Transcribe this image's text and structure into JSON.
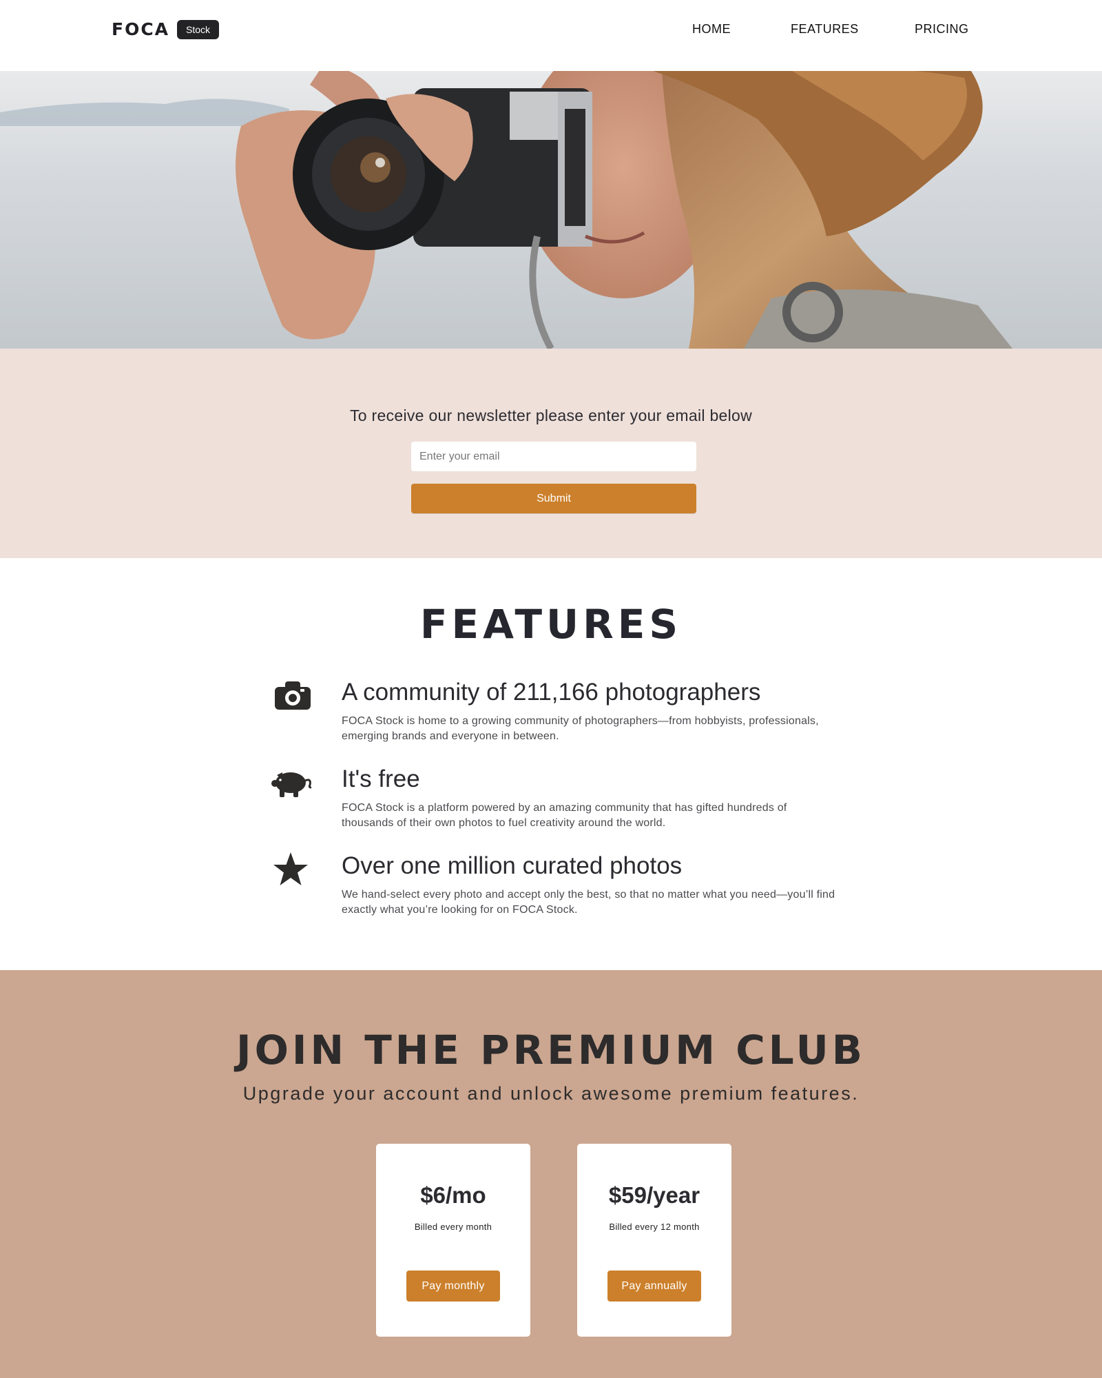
{
  "header": {
    "logo": "FOCA",
    "badge": "Stock",
    "nav": [
      "HOME",
      "FEATURES",
      "PRICING"
    ]
  },
  "hero": {
    "image_alt": "Woman in hat taking a photo with a film camera"
  },
  "newsletter": {
    "title": "To receive our newsletter please enter your email below",
    "email_placeholder": "Enter your email",
    "submit_label": "Submit"
  },
  "features": {
    "title": "FEATURES",
    "items": [
      {
        "icon": "camera-icon",
        "title": "A community of 211,166 photographers",
        "text": "FOCA Stock is home to a growing community of photographers—from hobbyists, professionals, emerging brands and everyone in between."
      },
      {
        "icon": "piggy-bank-icon",
        "title": "It's free",
        "text": "FOCA Stock is a platform powered by an amazing community that has gifted hundreds of thousands of their own photos to fuel creativity around the world."
      },
      {
        "icon": "star-icon",
        "title": "Over one million curated photos",
        "text": "We hand-select every photo and accept only the best, so that no matter what you need—you’ll find exactly what you’re looking for on FOCA Stock."
      }
    ]
  },
  "premium": {
    "title": "JOIN THE PREMIUM CLUB",
    "subtitle": "Upgrade your account and unlock awesome premium features.",
    "plans": [
      {
        "price": "$6/mo",
        "billed": "Billed every month",
        "button": "Pay monthly"
      },
      {
        "price": "$59/year",
        "billed": "Billed every 12 month",
        "button": "Pay annually"
      }
    ]
  },
  "colors": {
    "accent": "#cc802b",
    "newsletter_bg": "#efe0da",
    "premium_bg": "#cba690",
    "text_dark": "#2a2a2f"
  }
}
